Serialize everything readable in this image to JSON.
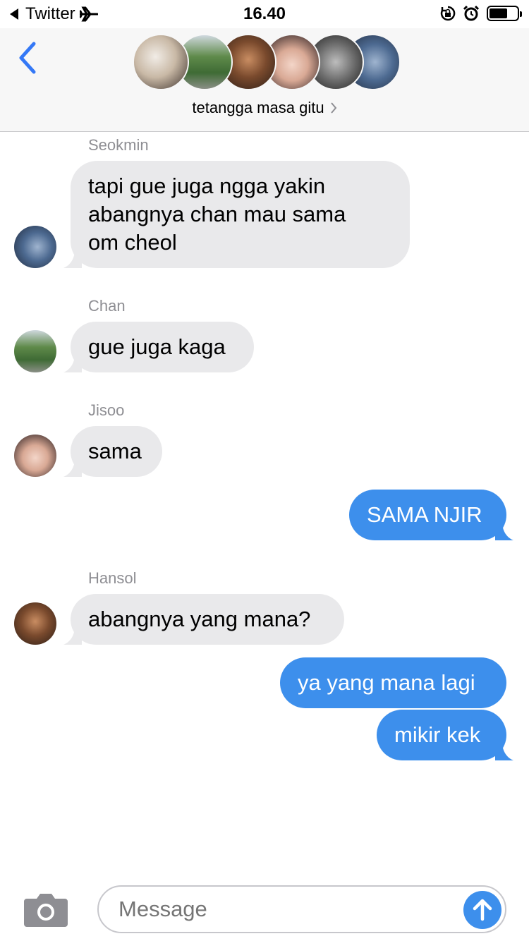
{
  "status_bar": {
    "back_app": "Twitter",
    "time": "16.40",
    "battery_level": 0.65
  },
  "header": {
    "group_name": "tetangga masa gitu",
    "avatar_count": 6
  },
  "messages": [
    {
      "direction": "in",
      "sender": "Seokmin",
      "lines": [
        "tapi gue juga ngga yakin",
        "abangnya chan mau sama",
        "om cheol"
      ]
    },
    {
      "direction": "in",
      "sender": "Chan",
      "lines": [
        "gue juga kaga"
      ]
    },
    {
      "direction": "in",
      "sender": "Jisoo",
      "lines": [
        "sama"
      ]
    },
    {
      "direction": "out",
      "lines": [
        "SAMA NJIR"
      ]
    },
    {
      "direction": "in",
      "sender": "Hansol",
      "lines": [
        "abangnya yang mana?"
      ]
    },
    {
      "direction": "out",
      "lines": [
        "ya yang mana lagi"
      ]
    },
    {
      "direction": "out",
      "lines": [
        "mikir kek"
      ]
    }
  ],
  "input": {
    "placeholder": "Message"
  },
  "colors": {
    "incoming_bubble": "#e9e9eb",
    "outgoing_bubble": "#3d8fec",
    "accent": "#3478f6",
    "sender_gray": "#8e8e93"
  }
}
